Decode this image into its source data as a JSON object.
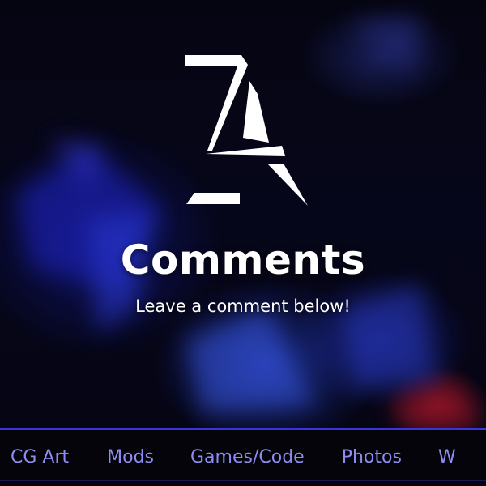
{
  "hero": {
    "title": "Comments",
    "subtitle": "Leave a comment below!"
  },
  "logo": {
    "icon": "stylized-z-a-logo-icon",
    "color": "#ffffff"
  },
  "nav": {
    "accent_color": "#3a35d8",
    "link_color": "#8e8cf0",
    "items": [
      {
        "label": "CG Art"
      },
      {
        "label": "Mods"
      },
      {
        "label": "Games/Code"
      },
      {
        "label": "Photos"
      },
      {
        "label": "W"
      }
    ]
  }
}
